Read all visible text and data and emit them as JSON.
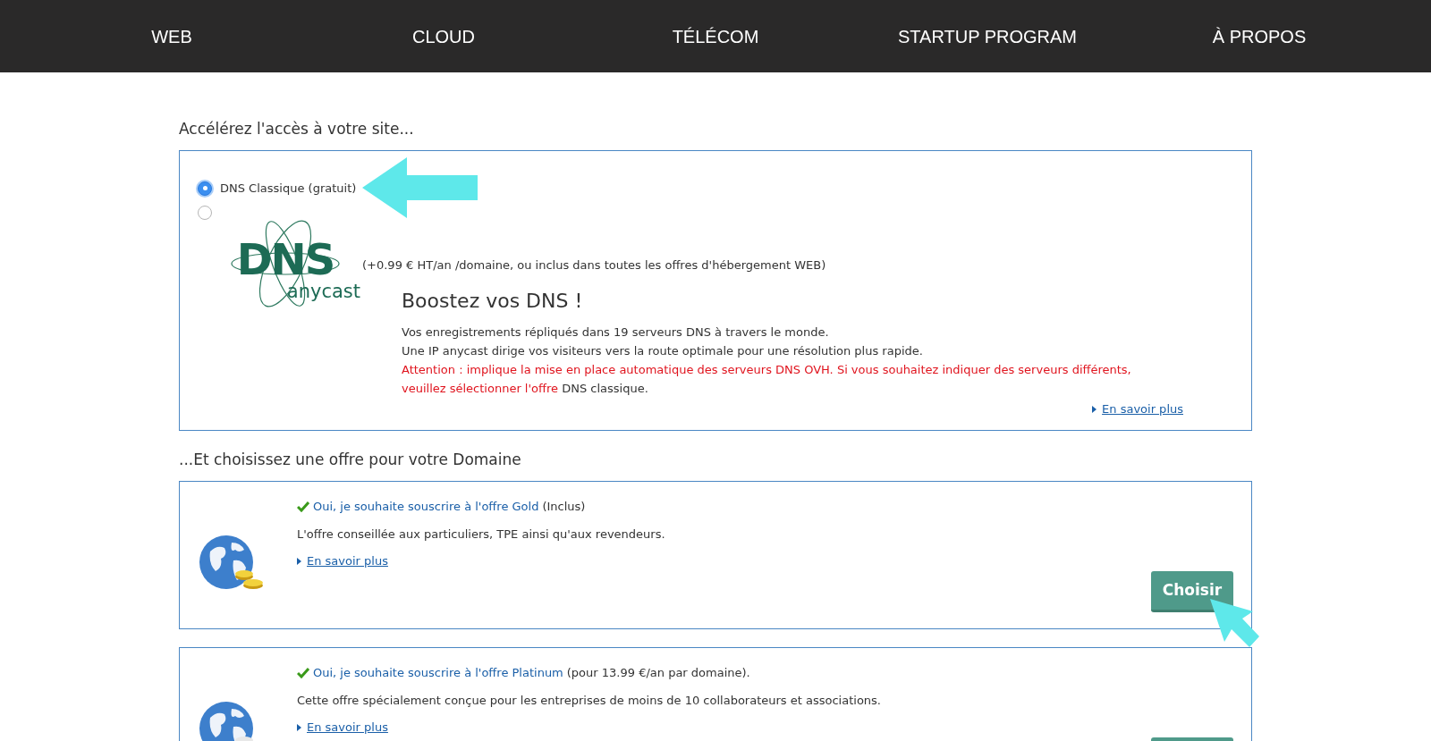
{
  "nav": [
    {
      "label": "WEB"
    },
    {
      "label": "CLOUD"
    },
    {
      "label": "TÉLÉCOM"
    },
    {
      "label": "STARTUP PROGRAM"
    },
    {
      "label": "À PROPOS"
    }
  ],
  "dns_section": {
    "heading": "Accélérez l'accès à votre site...",
    "options": [
      {
        "kind": "classic",
        "selected": true,
        "label": "DNS Classique (gratuit)"
      },
      {
        "kind": "anycast",
        "selected": false,
        "logo_text": "DNS",
        "logo_subtext": "anycast",
        "price": "(+0.99 € HT/an /domaine, ou inclus dans toutes les offres d'hébergement WEB)",
        "title": "Boostez vos DNS !",
        "lines": [
          "Vos enregistrements répliqués dans 19 serveurs DNS à travers le monde.",
          "Une IP anycast dirige vos visiteurs vers la route optimale pour une résolution plus rapide."
        ],
        "warning": "Attention : implique la mise en place automatique des serveurs DNS OVH. Si vous souhaitez indiquer des serveurs différents, veuillez sélectionner l'offre",
        "warning_tail": "DNS classique.",
        "link": "En savoir plus"
      }
    ]
  },
  "offers_section": {
    "heading": "...Et choisissez une offre pour votre Domaine",
    "offers": [
      {
        "kind": "gold",
        "title": "Oui, je souhaite souscrire à l'offre Gold",
        "note": "(Inclus)",
        "description": "L'offre conseillée aux particuliers, TPE ainsi qu'aux revendeurs.",
        "link": "En savoir plus",
        "button": "Choisir"
      },
      {
        "kind": "platinum",
        "title": "Oui, je souhaite souscrire à l'offre Platinum",
        "note": "(pour 13.99 €/an par domaine).",
        "description": "Cette offre spécialement conçue pour les entreprises de moins de 10 collaborateurs et associations.",
        "link": "En savoir plus"
      }
    ]
  }
}
